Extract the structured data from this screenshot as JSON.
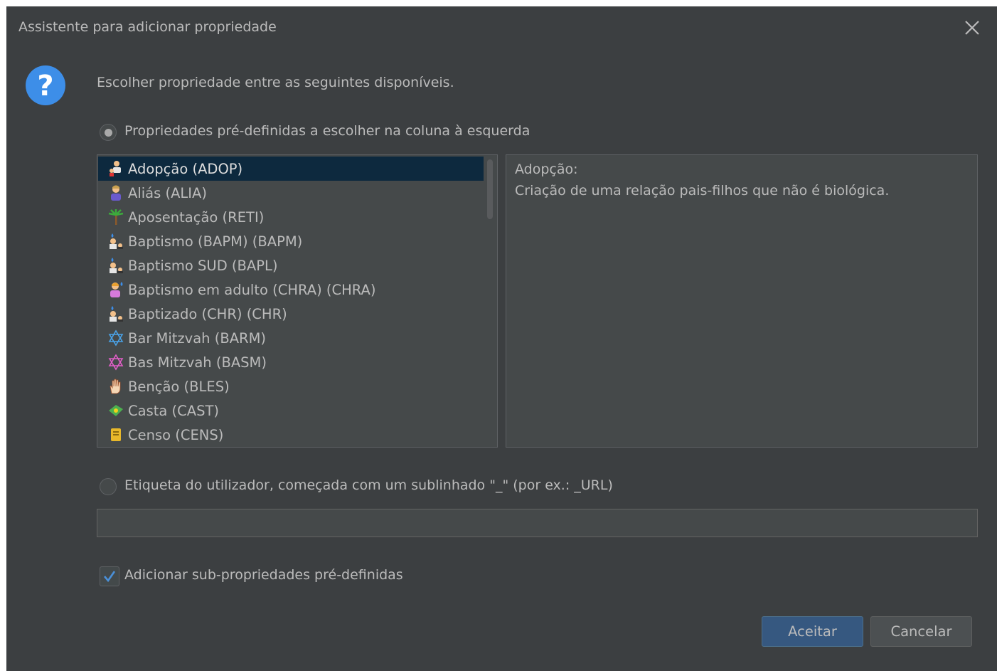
{
  "window": {
    "title": "Assistente para adicionar propriedade"
  },
  "prompt": "Escolher propriedade entre as seguintes disponíveis.",
  "option_predefined": {
    "label": "Propriedades pré-definidas a escolher na coluna à esquerda",
    "checked": true
  },
  "properties": [
    {
      "label": "Adopção (ADOP)",
      "icon": "adoption-icon",
      "selected": true
    },
    {
      "label": "Aliás (ALIA)",
      "icon": "person-icon"
    },
    {
      "label": "Aposentação (RETI)",
      "icon": "palm-tree-icon"
    },
    {
      "label": "Baptismo (BAPM) (BAPM)",
      "icon": "baptism-icon"
    },
    {
      "label": "Baptismo SUD (BAPL)",
      "icon": "baptism-icon"
    },
    {
      "label": "Baptismo em adulto (CHRA) (CHRA)",
      "icon": "adult-baptism-icon"
    },
    {
      "label": "Baptizado (CHR) (CHR)",
      "icon": "baptism-icon"
    },
    {
      "label": "Bar Mitzvah (BARM)",
      "icon": "star-of-david-blue-icon"
    },
    {
      "label": "Bas Mitzvah (BASM)",
      "icon": "star-of-david-pink-icon"
    },
    {
      "label": "Benção (BLES)",
      "icon": "blessing-hand-icon"
    },
    {
      "label": "Casta (CAST)",
      "icon": "caste-icon"
    },
    {
      "label": "Censo (CENS)",
      "icon": "census-icon"
    }
  ],
  "description": {
    "title": "Adopção:",
    "text": "Criação de uma relação pais-filhos que não é biológica."
  },
  "option_custom": {
    "label": "Etiqueta do utilizador, começada com um sublinhado \"_\" (por ex.: _URL)",
    "checked": false
  },
  "custom_tag": {
    "value": ""
  },
  "add_subprops": {
    "label": "Adicionar sub-propriedades pré-definidas",
    "checked": true
  },
  "buttons": {
    "ok": "Aceitar",
    "cancel": "Cancelar"
  },
  "colors": {
    "background": "#3c3f41",
    "selection": "#0d293e",
    "primary_button": "#365880",
    "question_icon": "#3d8ee8"
  }
}
